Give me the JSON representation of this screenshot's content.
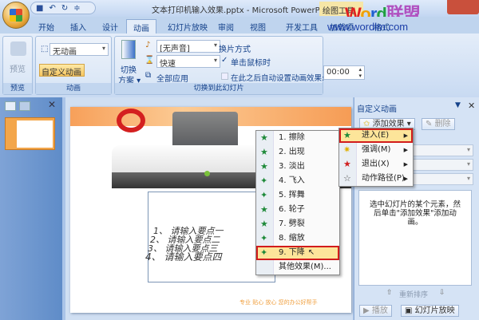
{
  "window": {
    "title": "文本打印机输入效果.pptx - Microsoft PowerPoint",
    "context_tab": "绘图工具"
  },
  "watermark": {
    "logo": "Word联盟",
    "url": "www.wordlm.com"
  },
  "tabs": [
    "开始",
    "插入",
    "设计",
    "动画",
    "幻灯片放映",
    "审阅",
    "视图",
    "开发工具",
    "加载项",
    "格式"
  ],
  "ribbon": {
    "preview": {
      "button": "预览",
      "group": "预览"
    },
    "animation": {
      "select": "无动画",
      "custom": "自定义动画",
      "group": "动画"
    },
    "transition": {
      "scheme": "切换",
      "scheme2": "方案 ▾",
      "sound": "[无声音]",
      "speed": "快速",
      "apply_all": "全部应用",
      "mode_label": "换片方式",
      "on_click": "单击鼠标时",
      "auto_after": "在此之后自动设置动画效果:",
      "time": "00:00",
      "group": "切换到此幻灯片"
    }
  },
  "slide": {
    "bullets": [
      "1、 请输入要点一",
      "2、 请输入要点二",
      "3、 请输入要点三",
      "4、 请输入要点四"
    ],
    "footer": "专业 贴心 放心 您的办公好帮手"
  },
  "effect_menu": {
    "items": [
      "1. 擦除",
      "2. 出现",
      "3. 淡出",
      "4. 飞入",
      "5. 挥舞",
      "6. 轮子",
      "7. 劈裂",
      "8. 缩放",
      "9. 下降"
    ],
    "more": "其他效果(M)..."
  },
  "sub_menu": {
    "items": [
      "进入(E)",
      "强调(M)",
      "退出(X)",
      "动作路径(P)"
    ]
  },
  "task_pane": {
    "title": "自定义动画",
    "add_effect": "添加效果 ▾",
    "remove": "删除",
    "hint": "选中幻灯片的某个元素，然后单击\"添加效果\"添加动画。",
    "reorder": "重新排序",
    "play": "▶ 播放",
    "slideshow": "幻灯片放映"
  }
}
